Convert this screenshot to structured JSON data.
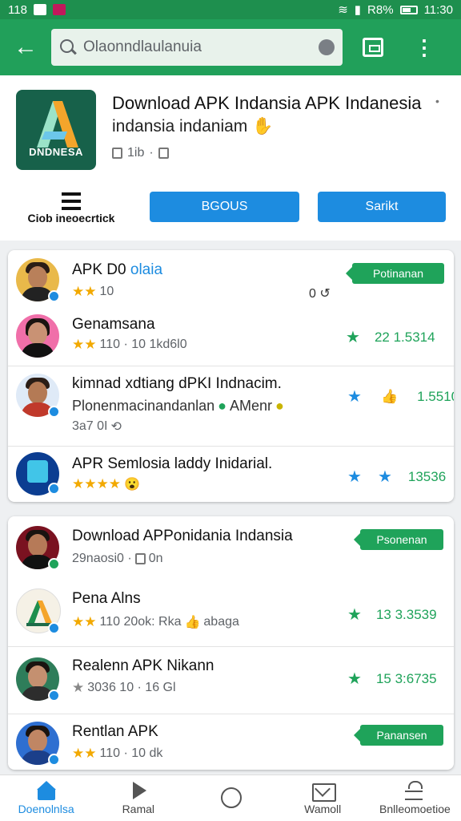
{
  "status_bar": {
    "left_text": "118",
    "right_text": "R8%",
    "time": "11:30"
  },
  "app_bar": {
    "search_text": "Olaonndlaulanuia",
    "icons": {
      "back": "back-arrow-icon",
      "search": "search-icon",
      "mic": "mic-icon",
      "apps": "app-grid-icon",
      "more": "more-vert-icon"
    }
  },
  "app": {
    "logo_text": "DNDNESA",
    "title": "Download APK Indansia APK Indanesia",
    "subtitle": "indansia indaniam",
    "meta": "1ib",
    "info_label": "Ciob ineoecrtick",
    "primary_button": "BGOUS",
    "secondary_button": "Sarikt",
    "colors": {
      "brand_green": "#21a05a",
      "accent_blue": "#1d8ce0",
      "logo_bg": "#17614a"
    }
  },
  "card1": {
    "rows": [
      {
        "title": "APK D0",
        "title_accent": "olaia",
        "sub": "10",
        "stars": "★★",
        "count": "0",
        "badge": "Potinanan"
      },
      {
        "title": "Genamsana",
        "sub": "110 · 10 1kd6l0",
        "stars": "★★",
        "rating": "22 1.5314"
      },
      {
        "title": "kimnad xdtiang dPKI Indnacim.",
        "sub": "Plonenmacinandanlan",
        "sub_extra": "AMenr",
        "sub3": "3a7 0I",
        "rating": "1.5510"
      },
      {
        "title": "APR Semlosia laddy Inidarial.",
        "stars": "★★★★",
        "rating": "13536"
      }
    ]
  },
  "card2": {
    "rows": [
      {
        "title": "Download APPonidania Indansia",
        "sub": "29naosi0 ·",
        "sub_extra": "0n",
        "badge": "Psonenan"
      },
      {
        "title": "Pena Alns",
        "sub": "110  20ok: Rka",
        "sub_extra": "abaga",
        "stars": "★★",
        "rating": "13 3.3539"
      },
      {
        "title": "Realenn APK Nikann",
        "sub": "3036 10 · 16 Gl",
        "stars": "★",
        "rating": "15 3:6735"
      },
      {
        "title": "Rentlan APK",
        "sub": "110 · 10 dk",
        "stars": "★★",
        "badge": "Panansen"
      }
    ]
  },
  "bottom_nav": [
    {
      "label": "Doenolnlsa",
      "icon": "home-icon"
    },
    {
      "label": "Ramal",
      "icon": "play-icon"
    },
    {
      "label": "",
      "icon": "circle-icon"
    },
    {
      "label": "Wamoll",
      "icon": "mail-icon"
    },
    {
      "label": "Bnlleomoetioe",
      "icon": "library-icon"
    }
  ]
}
